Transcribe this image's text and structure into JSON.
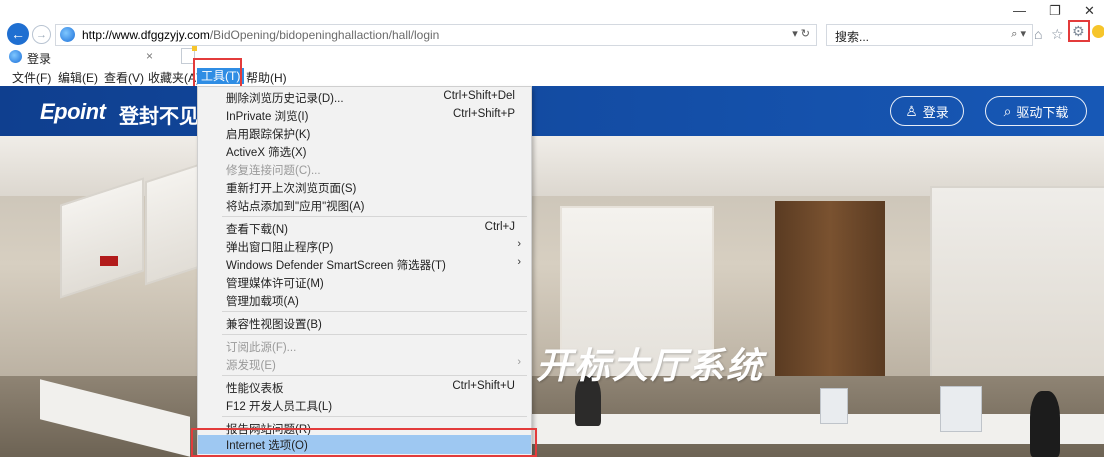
{
  "browser": {
    "url_host": "http://www.dfggzyjy.com",
    "url_path": "/BidOpening/bidopeninghallaction/hall/login",
    "addr_tools": "▾ ↻",
    "search_placeholder": "搜索...",
    "search_dropdown": "▾",
    "tab_title": "登录",
    "tab_close": "×",
    "win_minimize": "—",
    "win_restore": "❐",
    "win_close": "✕",
    "icons": {
      "back": "arrow-left-icon",
      "forward": "arrow-right-icon",
      "home": "home-icon",
      "favorites": "star-icon",
      "tools": "gear-icon",
      "feedback": "smiley-icon"
    }
  },
  "menubar": {
    "file": "文件(F)",
    "edit": "编辑(E)",
    "view": "查看(V)",
    "favorites": "收藏夹(A)",
    "tools": "工具(T)",
    "help": "帮助(H)"
  },
  "page": {
    "logo": "Epoint",
    "title": "登封不见",
    "login": "登录",
    "driver_download": "驱动下载",
    "slogan": "开标大厅系统"
  },
  "tools_menu": {
    "delete_history": {
      "label": "删除浏览历史记录(D)...",
      "shortcut": "Ctrl+Shift+Del"
    },
    "inprivate": {
      "label": "InPrivate 浏览(I)",
      "shortcut": "Ctrl+Shift+P"
    },
    "tracking": {
      "label": "启用跟踪保护(K)"
    },
    "activex": {
      "label": "ActiveX 筛选(X)"
    },
    "fix_conn": {
      "label": "修复连接问题(C)..."
    },
    "reopen": {
      "label": "重新打开上次浏览页面(S)"
    },
    "add_apps": {
      "label": "将站点添加到\"应用\"视图(A)"
    },
    "downloads": {
      "label": "查看下载(N)",
      "shortcut": "Ctrl+J"
    },
    "popup": {
      "label": "弹出窗口阻止程序(P)",
      "arrow": "›"
    },
    "smartscreen": {
      "label": "Windows Defender SmartScreen 筛选器(T)",
      "arrow": "›"
    },
    "media": {
      "label": "管理媒体许可证(M)"
    },
    "addons": {
      "label": "管理加载项(A)"
    },
    "compat": {
      "label": "兼容性视图设置(B)"
    },
    "subscribe": {
      "label": "订阅此源(F)..."
    },
    "feeds": {
      "label": "源发现(E)",
      "arrow": "›"
    },
    "perf": {
      "label": "性能仪表板",
      "shortcut": "Ctrl+Shift+U"
    },
    "devtools": {
      "label": "F12 开发人员工具(L)"
    },
    "report": {
      "label": "报告网站问题(R)"
    },
    "internet_options": {
      "label": "Internet 选项(O)"
    }
  },
  "colors": {
    "highlight_box": "#e33b3b",
    "menu_selected": "#2f8de4",
    "item_highlight": "#9ec8f2",
    "header_blue": "#1758b6"
  }
}
